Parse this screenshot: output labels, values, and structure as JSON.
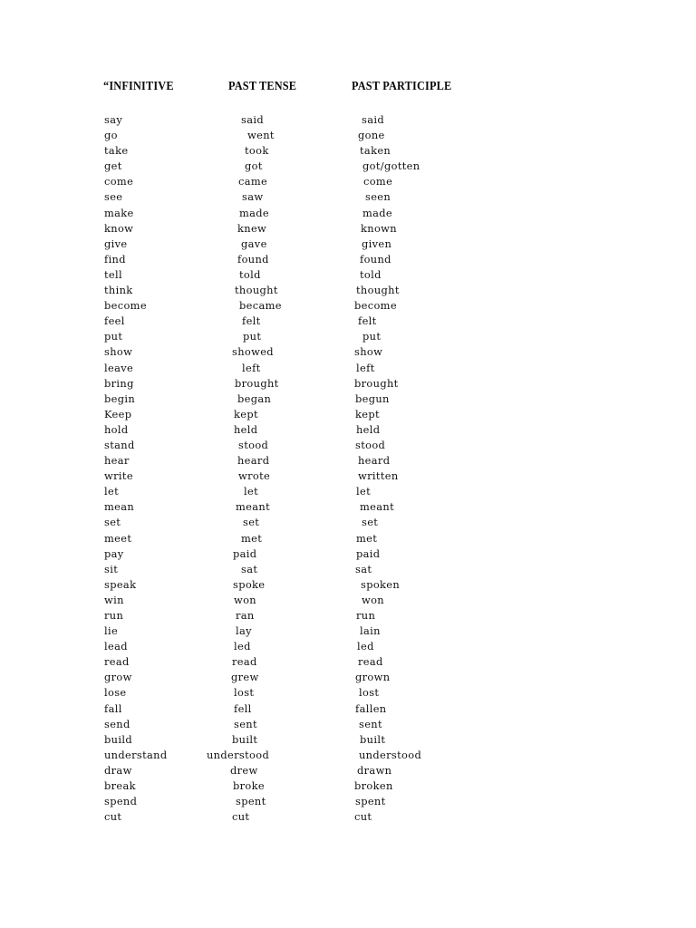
{
  "document": {
    "title": "Irregular Verbs Table",
    "background_color": "#ffffff",
    "text_color": "#111111"
  },
  "table": {
    "headers": {
      "infinitive": "“INFINITIVE",
      "past_tense": "PAST TENSE",
      "past_participle": "PAST PARTICIPLE"
    },
    "rows": [
      {
        "infinitive": "say",
        "past_tense": "said",
        "past_participle": "said",
        "dx1": 0,
        "dx2": 14,
        "dx3": 8
      },
      {
        "infinitive": "go",
        "past_tense": "went",
        "past_participle": "gone",
        "dx1": 0,
        "dx2": 21,
        "dx3": 4
      },
      {
        "infinitive": "take",
        "past_tense": "took",
        "past_participle": "taken",
        "dx1": 0,
        "dx2": 18,
        "dx3": 6
      },
      {
        "infinitive": "get",
        "past_tense": "got",
        "past_participle": "got/gotten",
        "dx1": 0,
        "dx2": 18,
        "dx3": 9
      },
      {
        "infinitive": "come",
        "past_tense": "came",
        "past_participle": "come",
        "dx1": 0,
        "dx2": 11,
        "dx3": 10
      },
      {
        "infinitive": "see",
        "past_tense": "saw",
        "past_participle": "seen",
        "dx1": 0,
        "dx2": 15,
        "dx3": 12
      },
      {
        "infinitive": "make",
        "past_tense": "made",
        "past_participle": "made",
        "dx1": 0,
        "dx2": 12,
        "dx3": 9
      },
      {
        "infinitive": "know",
        "past_tense": "knew",
        "past_participle": "known",
        "dx1": 0,
        "dx2": 10,
        "dx3": 7
      },
      {
        "infinitive": "give",
        "past_tense": "gave",
        "past_participle": "given",
        "dx1": 0,
        "dx2": 14,
        "dx3": 8
      },
      {
        "infinitive": "find",
        "past_tense": "found",
        "past_participle": "found",
        "dx1": 0,
        "dx2": 10,
        "dx3": 6
      },
      {
        "infinitive": "tell",
        "past_tense": "told",
        "past_participle": "told",
        "dx1": 0,
        "dx2": 12,
        "dx3": 6
      },
      {
        "infinitive": "think",
        "past_tense": "thought",
        "past_participle": "thought",
        "dx1": 0,
        "dx2": 7,
        "dx3": 2
      },
      {
        "infinitive": "become",
        "past_tense": "became",
        "past_participle": "become",
        "dx1": 0,
        "dx2": 12,
        "dx3": 0
      },
      {
        "infinitive": "feel",
        "past_tense": "felt",
        "past_participle": "felt",
        "dx1": 0,
        "dx2": 15,
        "dx3": 4
      },
      {
        "infinitive": "put",
        "past_tense": "put",
        "past_participle": "put",
        "dx1": 0,
        "dx2": 16,
        "dx3": 9
      },
      {
        "infinitive": "show",
        "past_tense": "showed",
        "past_participle": "show",
        "dx1": 0,
        "dx2": 4,
        "dx3": 0
      },
      {
        "infinitive": "leave",
        "past_tense": "left",
        "past_participle": "left",
        "dx1": 0,
        "dx2": 15,
        "dx3": 2
      },
      {
        "infinitive": "bring",
        "past_tense": "brought",
        "past_participle": "brought",
        "dx1": 0,
        "dx2": 7,
        "dx3": 0
      },
      {
        "infinitive": "begin",
        "past_tense": "began",
        "past_participle": "begun",
        "dx1": 0,
        "dx2": 10,
        "dx3": 1
      },
      {
        "infinitive": "Keep",
        "past_tense": "kept",
        "past_participle": "kept",
        "dx1": 0,
        "dx2": 6,
        "dx3": 1
      },
      {
        "infinitive": "hold",
        "past_tense": "held",
        "past_participle": "held",
        "dx1": 0,
        "dx2": 6,
        "dx3": 2
      },
      {
        "infinitive": "stand",
        "past_tense": "stood",
        "past_participle": "stood",
        "dx1": 0,
        "dx2": 11,
        "dx3": 1
      },
      {
        "infinitive": "hear",
        "past_tense": "heard",
        "past_participle": "heard",
        "dx1": 0,
        "dx2": 10,
        "dx3": 4
      },
      {
        "infinitive": "write",
        "past_tense": "wrote",
        "past_participle": "written",
        "dx1": 0,
        "dx2": 11,
        "dx3": 4
      },
      {
        "infinitive": "let",
        "past_tense": "let",
        "past_participle": "let",
        "dx1": 0,
        "dx2": 17,
        "dx3": 2
      },
      {
        "infinitive": "mean",
        "past_tense": "meant",
        "past_participle": "meant",
        "dx1": 0,
        "dx2": 8,
        "dx3": 6
      },
      {
        "infinitive": "set",
        "past_tense": "set",
        "past_participle": "set",
        "dx1": 0,
        "dx2": 16,
        "dx3": 8
      },
      {
        "infinitive": "meet",
        "past_tense": "met",
        "past_participle": "met",
        "dx1": 0,
        "dx2": 14,
        "dx3": 2
      },
      {
        "infinitive": "pay",
        "past_tense": "paid",
        "past_participle": "paid",
        "dx1": 0,
        "dx2": 5,
        "dx3": 2
      },
      {
        "infinitive": "sit",
        "past_tense": "sat",
        "past_participle": "sat",
        "dx1": 0,
        "dx2": 14,
        "dx3": 1
      },
      {
        "infinitive": "speak",
        "past_tense": "spoke",
        "past_participle": "spoken",
        "dx1": 0,
        "dx2": 5,
        "dx3": 7
      },
      {
        "infinitive": "win",
        "past_tense": "won",
        "past_participle": "won",
        "dx1": 0,
        "dx2": 6,
        "dx3": 8
      },
      {
        "infinitive": "run",
        "past_tense": "ran",
        "past_participle": "run",
        "dx1": 0,
        "dx2": 8,
        "dx3": 2
      },
      {
        "infinitive": "lie",
        "past_tense": "lay",
        "past_participle": "lain",
        "dx1": 0,
        "dx2": 8,
        "dx3": 6
      },
      {
        "infinitive": "lead",
        "past_tense": "led",
        "past_participle": "led",
        "dx1": 0,
        "dx2": 6,
        "dx3": 3
      },
      {
        "infinitive": "read",
        "past_tense": "read",
        "past_participle": "read",
        "dx1": 0,
        "dx2": 4,
        "dx3": 4
      },
      {
        "infinitive": "grow",
        "past_tense": "grew",
        "past_participle": "grown",
        "dx1": 0,
        "dx2": 3,
        "dx3": 1
      },
      {
        "infinitive": "lose",
        "past_tense": "lost",
        "past_participle": "lost",
        "dx1": 0,
        "dx2": 6,
        "dx3": 5
      },
      {
        "infinitive": "fall",
        "past_tense": "fell",
        "past_participle": "fallen",
        "dx1": 0,
        "dx2": 6,
        "dx3": 1
      },
      {
        "infinitive": "send",
        "past_tense": "sent",
        "past_participle": "sent",
        "dx1": 0,
        "dx2": 6,
        "dx3": 5
      },
      {
        "infinitive": "build",
        "past_tense": "built",
        "past_participle": "built",
        "dx1": 0,
        "dx2": 4,
        "dx3": 6
      },
      {
        "infinitive": "understand",
        "past_tense": "understood",
        "past_participle": "understood",
        "dx1": 0,
        "dx2": -24,
        "dx3": 5
      },
      {
        "infinitive": "draw",
        "past_tense": "drew",
        "past_participle": "drawn",
        "dx1": 0,
        "dx2": 2,
        "dx3": 3
      },
      {
        "infinitive": "break",
        "past_tense": "broke",
        "past_participle": "broken",
        "dx1": 0,
        "dx2": 5,
        "dx3": 0
      },
      {
        "infinitive": "spend",
        "past_tense": "spent",
        "past_participle": "spent",
        "dx1": 0,
        "dx2": 8,
        "dx3": 1
      },
      {
        "infinitive": "cut",
        "past_tense": "cut",
        "past_participle": "cut",
        "dx1": 0,
        "dx2": 4,
        "dx3": 0
      }
    ]
  }
}
